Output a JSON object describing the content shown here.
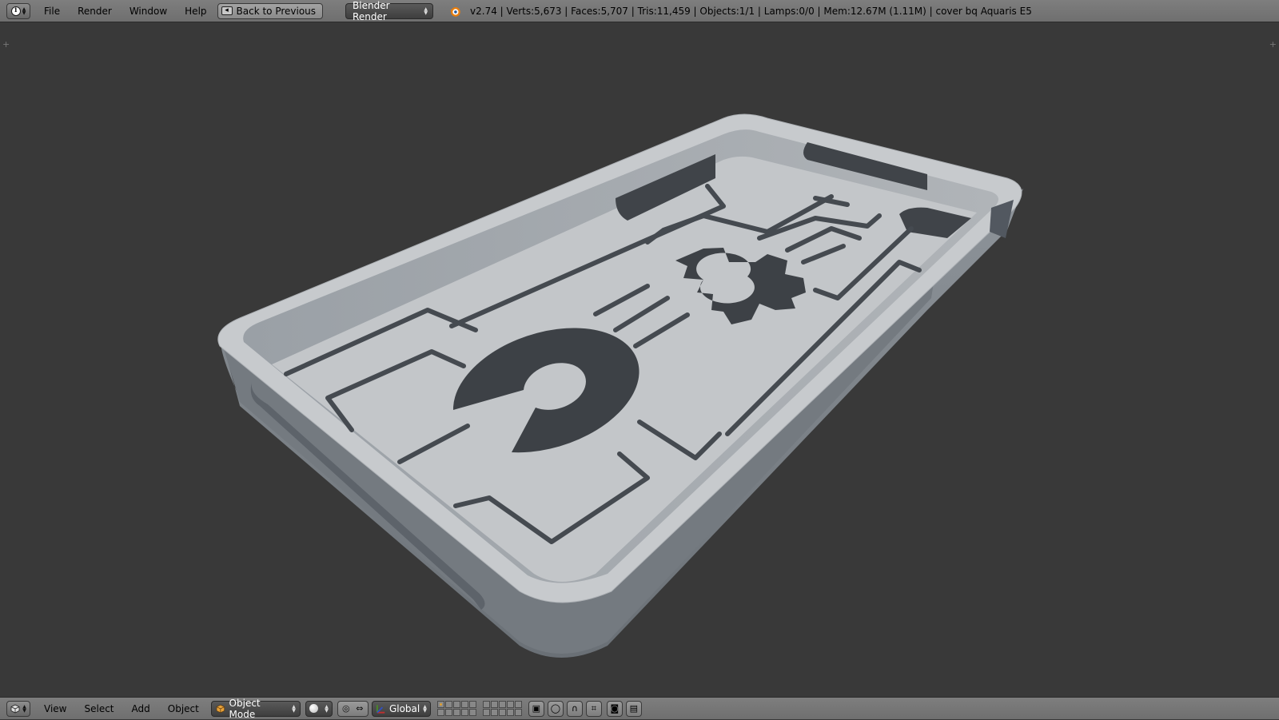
{
  "top_header": {
    "editor_icon": "info-icon",
    "menus": [
      "File",
      "Render",
      "Window",
      "Help"
    ],
    "back_button_label": "Back to Previous",
    "render_engine": "Blender Render",
    "stats": "v2.74 | Verts:5,673 | Faces:5,707 | Tris:11,459 | Objects:1/1 | Lamps:0/0 | Mem:12.67M (1.11M) | cover bq Aquaris E5"
  },
  "viewport": {
    "background_color": "#393939",
    "model_color": "#c3c6c9",
    "model_shadow_color": "#7c8288",
    "corner_widget": "+"
  },
  "bottom_header": {
    "editor_icon": "3d-view-cube-icon",
    "menus": [
      "View",
      "Select",
      "Add",
      "Object"
    ],
    "mode": "Object Mode",
    "viewport_shading": "solid-sphere-icon",
    "orientation": "Global"
  }
}
